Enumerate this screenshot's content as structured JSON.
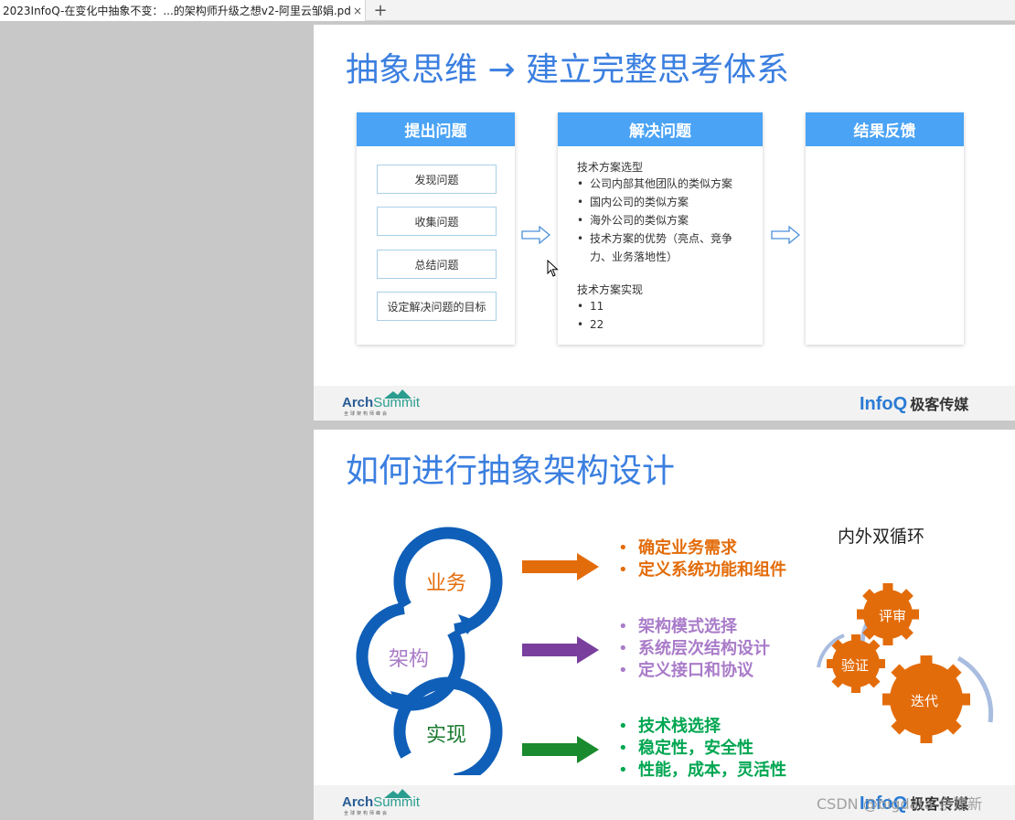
{
  "tab": {
    "title": "2023InfoQ-在变化中抽象不变：...的架构师升级之想v2-阿里云邹娟.pdf",
    "close": "×",
    "new_tab": "+"
  },
  "slide1": {
    "title": "抽象思维 → 建立完整思考体系",
    "col1": {
      "header": "提出问题",
      "items": [
        "发现问题",
        "收集问题",
        "总结问题",
        "设定解决问题的目标"
      ]
    },
    "col2": {
      "header": "解决问题",
      "section1_title": "技术方案选型",
      "section1_items": [
        "公司内部其他团队的类似方案",
        "国内公司的类似方案",
        "海外公司的类似方案",
        "技术方案的优势（亮点、竞争"
      ],
      "section1_continuation": "力、业务落地性）",
      "section2_title": "技术方案实现",
      "section2_items": [
        "11",
        "22"
      ]
    },
    "col3": {
      "header": "结果反馈"
    }
  },
  "slide2": {
    "title": "如何进行抽象架构设计",
    "loops": [
      "业务",
      "架构",
      "实现"
    ],
    "group1": [
      "确定业务需求",
      "定义系统功能和组件"
    ],
    "group2": [
      "架构模式选择",
      "系统层次结构设计",
      "定义接口和协议"
    ],
    "group3": [
      "技术栈选择",
      "稳定性，安全性",
      "性能，成本，灵活性"
    ],
    "cycle_title": "内外双循环",
    "gears": [
      "评审",
      "验证",
      "迭代"
    ]
  },
  "footer": {
    "arch": "Arch",
    "summit": "Summit",
    "arch_sub": "全球架构师峰会",
    "infoq": "InfoQ",
    "infoq_cn": "极客传媒"
  },
  "watermark": "CSDN @bigdata-余建新",
  "bullet_char": "•",
  "colors": {
    "accent": "#3b7fe0",
    "header": "#4aa3f5",
    "orange": "#e36c0a",
    "purple": "#a97bc9",
    "green": "#00a651",
    "ring": "#0f5fb8"
  }
}
